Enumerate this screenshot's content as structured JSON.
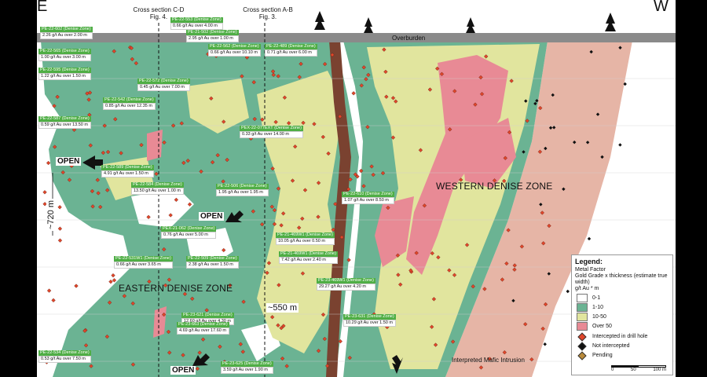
{
  "header": {
    "east": "E",
    "west": "W",
    "section_cd": "Cross section C-D\nFig. 4.",
    "section_ab": "Cross section A-B\nFig. 3.",
    "overburden": "Overburden"
  },
  "zones": {
    "western": "WESTERN DENISE ZONE",
    "eastern": "EASTERN DENISE ZONE",
    "mafic": "Interpreted Mafic Intrusion"
  },
  "open_labels": [
    "OPEN",
    "OPEN",
    "OPEN"
  ],
  "measurements": {
    "depth_left": "~720 m",
    "depth_mid": "~550 m"
  },
  "drill_labels": [
    {
      "name": "PE-22-602 (Denise Zone)",
      "value": "2.26 g/t Au over 2.00 m"
    },
    {
      "name": "PE-22-553 (Denise Zone)",
      "value": "0.66 g/t Au over 4.00 m"
    },
    {
      "name": "PE-21-502 (Denise Zone)",
      "value": "2.95 g/t Au over 1.00 m"
    },
    {
      "name": "PE-22-565 (Denise Zone)",
      "value": "1.00 g/t Au over 3.00 m"
    },
    {
      "name": "PE-22-562 (Denise Zone)",
      "value": "0.66 g/t Au over 10.10 m"
    },
    {
      "name": "PE-22-489 (Denise Zone)",
      "value": "0.71 g/t Au over 6.00 m"
    },
    {
      "name": "PE-22-595 (Denise Zone)",
      "value": "1.22 g/t Au over 1.50 m"
    },
    {
      "name": "PE-22-572 (Denise Zone)",
      "value": "0.45 g/t Au over 7.00 m"
    },
    {
      "name": "PE-22-542 (Denise Zone)",
      "value": "0.85 g/t Au over 12.35 m"
    },
    {
      "name": "PE-22-587 (Denise Zone)",
      "value": "0.59 g/t Au over 13.50 m"
    },
    {
      "name": "PEX-22-077EXT (Denise Zone)",
      "value": "0.33 g/t Au over 14.00 m"
    },
    {
      "name": "PE-22-589 (Denise Zone)",
      "value": "4.91 g/t Au over 1.50 m"
    },
    {
      "name": "PE-22-584 (Denise Zone)",
      "value": "13.50 g/t Au over 1.00 m"
    },
    {
      "name": "PE-22-506 (Denise Zone)",
      "value": "1.95 g/t Au over 1.95 m"
    },
    {
      "name": "PE-22-610 (Denise Zone)",
      "value": "1.07 g/t Au over 8.50 m"
    },
    {
      "name": "PEX-21-062 (Denise Zone)",
      "value": "0.76 g/t Au over 5.00 m"
    },
    {
      "name": "PE-21-469W1 (Denise Zone)",
      "value": "10.05 g/t Au over 0.50 m"
    },
    {
      "name": "PE-22-531W1 (Denise Zone)",
      "value": "0.66 g/t Au over 3.65 m"
    },
    {
      "name": "PE-22-509 (Denise Zone)",
      "value": "2.38 g/t Au over 1.50 m"
    },
    {
      "name": "PE-21-469W1 (Denise Zone)",
      "value": "7.42 g/t Au over 2.40 m"
    },
    {
      "name": "PE-23-469W1 (Denise Zone)",
      "value": "29.27 g/t Au over 4.20 m"
    },
    {
      "name": "PE-23-621 (Denise Zone)",
      "value": "12.60 g/t Au over 4.30 m"
    },
    {
      "name": "PE-23-663 (Denise Zone)",
      "value": "4.69 g/t Au over 17.60 m"
    },
    {
      "name": "PE-23-631 (Denise Zone)",
      "value": "10.29 g/t Au over 1.50 m"
    },
    {
      "name": "PE-22-534 (Denise Zone)",
      "value": "0.53 g/t Au over 7.50 m"
    },
    {
      "name": "PE-23-625 (Denise Zone)",
      "value": "3.59 g/t Au over 1.90 m"
    }
  ],
  "legend": {
    "title": "Legend:",
    "subtitle": "Metal Factor\nGold Grade x thickness (estimate true width)\ng/t Au * m",
    "classes": [
      {
        "label": "0-1",
        "color": "#ffffff"
      },
      {
        "label": "1-10",
        "color": "#6bb393"
      },
      {
        "label": "10-50",
        "color": "#e1e59e"
      },
      {
        "label": "Over 50",
        "color": "#e88a95"
      }
    ],
    "markers": [
      {
        "label": "Intercepted in drill hole",
        "color": "#e0462a"
      },
      {
        "label": "Not intercepted",
        "color": "#111111"
      },
      {
        "label": "Pending",
        "color": "#b8893a"
      }
    ],
    "scale": [
      "0",
      "50",
      "100 m"
    ]
  },
  "colors": {
    "green": "#6bb393",
    "yellow": "#e1e59e",
    "pink": "#e88a95",
    "salmon": "#e6b5a6",
    "dyke": "#7a4230",
    "overburden": "#8a8a8a",
    "label_green": "#4fae45"
  }
}
